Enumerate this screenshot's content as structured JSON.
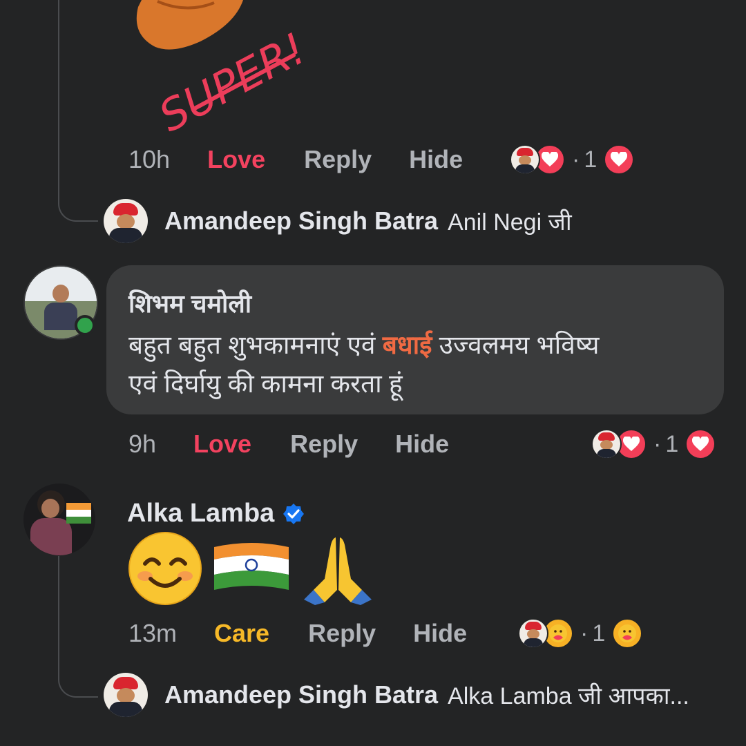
{
  "sticker": {
    "text": "SUPER!"
  },
  "comments": [
    {
      "meta": {
        "time": "10h",
        "reaction": "Love",
        "reply": "Reply",
        "hide": "Hide",
        "count": "1",
        "sep": "·"
      },
      "reply_preview": {
        "name": "Amandeep Singh Batra",
        "text": "Anil Negi जी"
      }
    },
    {
      "name": "शिभम चमोली",
      "text_before": "बहुत बहुत शुभकामनाएं एवं ",
      "text_highlight": "बधाई",
      "text_after": " उज्वलमय भविष्य",
      "text_line2": "एवं दिर्घायु की कामना करता हूं",
      "meta": {
        "time": "9h",
        "reaction": "Love",
        "reply": "Reply",
        "hide": "Hide",
        "count": "1",
        "sep": "·"
      }
    },
    {
      "name": "Alka Lamba",
      "emojis": [
        "😊",
        "🇮🇳",
        "🙏"
      ],
      "meta": {
        "time": "13m",
        "reaction": "Care",
        "reply": "Reply",
        "hide": "Hide",
        "count": "1",
        "sep": "·"
      },
      "reply_preview": {
        "name": "Amandeep Singh Batra",
        "text": "Alka Lamba जी आपका..."
      }
    }
  ],
  "colors": {
    "love": "#f3425f",
    "care": "#f7b928",
    "highlight": "#f06a43",
    "bubble": "#3a3b3c",
    "online": "#31a24c",
    "verified": "#1877f2"
  }
}
